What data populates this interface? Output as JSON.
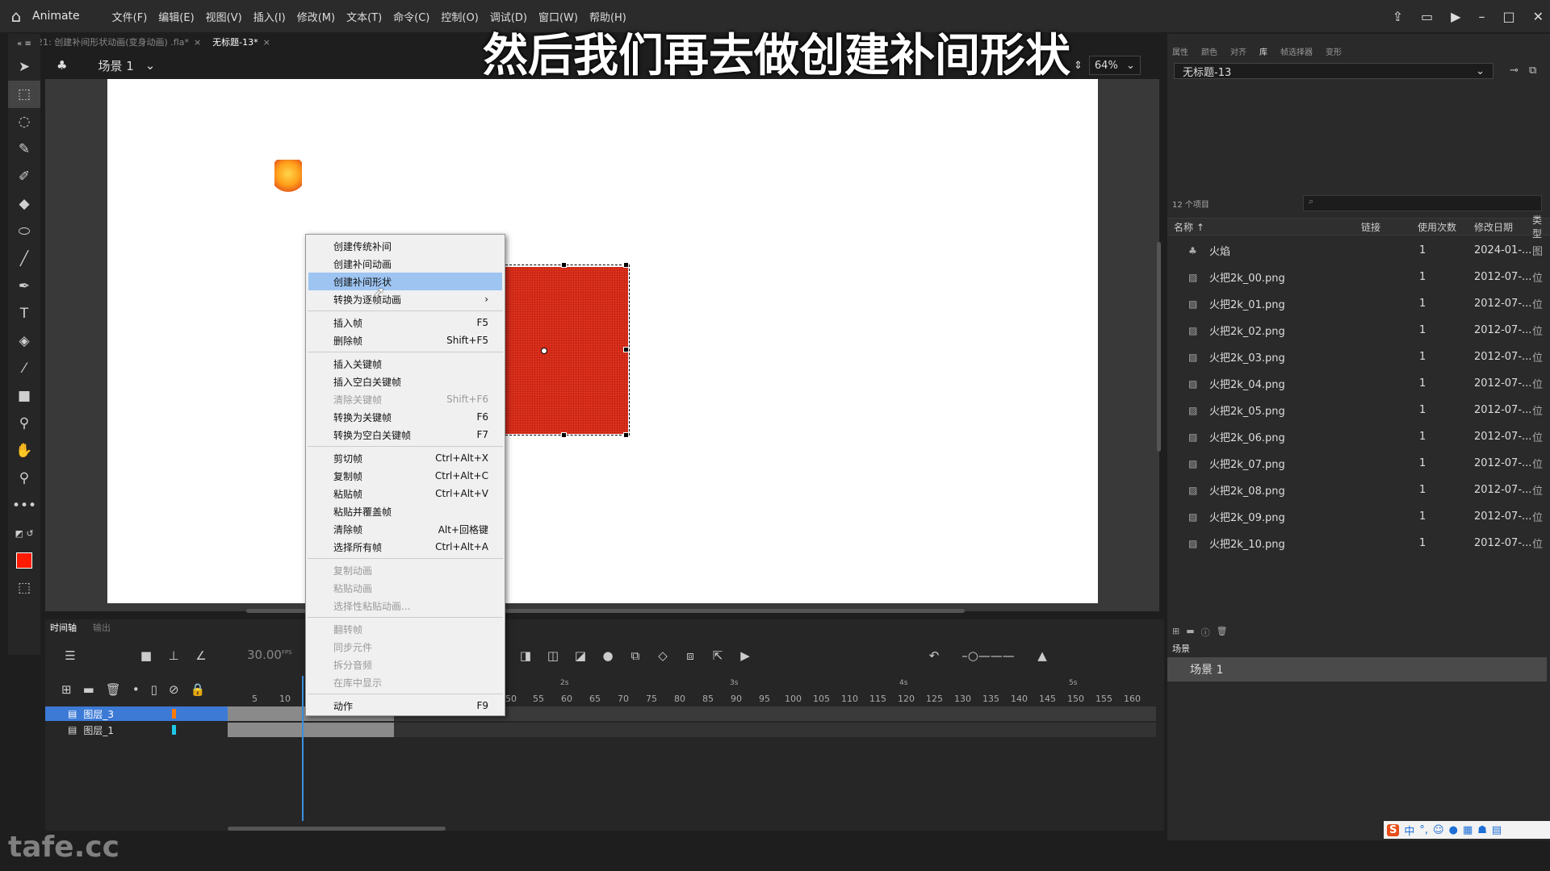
{
  "app": {
    "name": "Animate",
    "menus": [
      "文件(F)",
      "编辑(E)",
      "视图(V)",
      "插入(I)",
      "修改(M)",
      "文本(T)",
      "命令(C)",
      "控制(O)",
      "调试(D)",
      "窗口(W)",
      "帮助(H)"
    ]
  },
  "doc_tabs": [
    {
      "label": "21: 创建补间形状动画(变身动画) .fla*"
    },
    {
      "label": "无标题-13*"
    }
  ],
  "scene_bar": {
    "scene_label": "场景 1"
  },
  "subtitle": "然后我们再去做创建补间形状",
  "zoom": {
    "value": "64%"
  },
  "context_menu": {
    "items": [
      {
        "label": "创建传统补间",
        "shortcut": "",
        "state": "normal"
      },
      {
        "label": "创建补间动画",
        "shortcut": "",
        "state": "normal"
      },
      {
        "label": "创建补间形状",
        "shortcut": "",
        "state": "highlighted"
      },
      {
        "label": "转换为逐帧动画",
        "shortcut": "›",
        "state": "normal"
      },
      {
        "label": "插入帧",
        "shortcut": "F5",
        "state": "normal"
      },
      {
        "label": "删除帧",
        "shortcut": "Shift+F5",
        "state": "normal"
      },
      {
        "label": "插入关键帧",
        "shortcut": "",
        "state": "normal"
      },
      {
        "label": "插入空白关键帧",
        "shortcut": "",
        "state": "normal"
      },
      {
        "label": "清除关键帧",
        "shortcut": "Shift+F6",
        "state": "disabled"
      },
      {
        "label": "转换为关键帧",
        "shortcut": "F6",
        "state": "normal"
      },
      {
        "label": "转换为空白关键帧",
        "shortcut": "F7",
        "state": "normal"
      },
      {
        "label": "剪切帧",
        "shortcut": "Ctrl+Alt+X",
        "state": "normal"
      },
      {
        "label": "复制帧",
        "shortcut": "Ctrl+Alt+C",
        "state": "normal"
      },
      {
        "label": "粘贴帧",
        "shortcut": "Ctrl+Alt+V",
        "state": "normal"
      },
      {
        "label": "粘贴并覆盖帧",
        "shortcut": "",
        "state": "normal"
      },
      {
        "label": "清除帧",
        "shortcut": "Alt+回格键",
        "state": "normal"
      },
      {
        "label": "选择所有帧",
        "shortcut": "Ctrl+Alt+A",
        "state": "normal"
      },
      {
        "label": "复制动画",
        "shortcut": "",
        "state": "disabled"
      },
      {
        "label": "粘贴动画",
        "shortcut": "",
        "state": "disabled"
      },
      {
        "label": "选择性粘贴动画...",
        "shortcut": "",
        "state": "disabled"
      },
      {
        "label": "翻转帧",
        "shortcut": "",
        "state": "disabled"
      },
      {
        "label": "同步元件",
        "shortcut": "",
        "state": "disabled"
      },
      {
        "label": "拆分音频",
        "shortcut": "",
        "state": "disabled"
      },
      {
        "label": "在库中显示",
        "shortcut": "",
        "state": "disabled"
      },
      {
        "label": "动作",
        "shortcut": "F9",
        "state": "normal"
      }
    ]
  },
  "timeline": {
    "tabs": [
      "时间轴",
      "输出"
    ],
    "fps": "30.00",
    "fps_unit": "FPS",
    "ruler": [
      "5",
      "10",
      "50",
      "55",
      "60",
      "65",
      "70",
      "75",
      "80",
      "85",
      "90",
      "95",
      "100",
      "105",
      "110",
      "115",
      "120",
      "125",
      "130",
      "135",
      "140",
      "145",
      "150",
      "155",
      "160"
    ],
    "seconds": [
      "2s",
      "3s",
      "4s",
      "5s"
    ],
    "layers": [
      {
        "name": "图层_3",
        "color": "#ff7a00",
        "selected": true
      },
      {
        "name": "图层_1",
        "color": "#1ec8e6",
        "selected": false
      }
    ]
  },
  "right_panel": {
    "tabs": [
      "属性",
      "颜色",
      "对齐",
      "库",
      "帧选择器",
      "变形"
    ],
    "library_select": "无标题-13",
    "item_count": "12 个项目",
    "columns": [
      "名称 ↑",
      "链接",
      "使用次数",
      "修改日期",
      "类型"
    ],
    "items": [
      {
        "name": "火焰",
        "uses": "1",
        "date": "2024-01-...",
        "type": "图",
        "icon": "graphic-symbol-icon"
      },
      {
        "name": "火把2k_00.png",
        "uses": "1",
        "date": "2012-07-...",
        "type": "位",
        "icon": "bitmap-icon"
      },
      {
        "name": "火把2k_01.png",
        "uses": "1",
        "date": "2012-07-...",
        "type": "位",
        "icon": "bitmap-icon"
      },
      {
        "name": "火把2k_02.png",
        "uses": "1",
        "date": "2012-07-...",
        "type": "位",
        "icon": "bitmap-icon"
      },
      {
        "name": "火把2k_03.png",
        "uses": "1",
        "date": "2012-07-...",
        "type": "位",
        "icon": "bitmap-icon"
      },
      {
        "name": "火把2k_04.png",
        "uses": "1",
        "date": "2012-07-...",
        "type": "位",
        "icon": "bitmap-icon"
      },
      {
        "name": "火把2k_05.png",
        "uses": "1",
        "date": "2012-07-...",
        "type": "位",
        "icon": "bitmap-icon"
      },
      {
        "name": "火把2k_06.png",
        "uses": "1",
        "date": "2012-07-...",
        "type": "位",
        "icon": "bitmap-icon"
      },
      {
        "name": "火把2k_07.png",
        "uses": "1",
        "date": "2012-07-...",
        "type": "位",
        "icon": "bitmap-icon"
      },
      {
        "name": "火把2k_08.png",
        "uses": "1",
        "date": "2012-07-...",
        "type": "位",
        "icon": "bitmap-icon"
      },
      {
        "name": "火把2k_09.png",
        "uses": "1",
        "date": "2012-07-...",
        "type": "位",
        "icon": "bitmap-icon"
      },
      {
        "name": "火把2k_10.png",
        "uses": "1",
        "date": "2012-07-...",
        "type": "位",
        "icon": "bitmap-icon"
      }
    ],
    "scenes_title": "场景",
    "scene_item": "场景 1"
  },
  "watermark": "tafe.cc",
  "ime": {
    "label": "中"
  },
  "colors": {
    "fill": "#ff1a00",
    "stroke": "#000000",
    "accent": "#3c7ad6",
    "menu_highlight": "#9ec5f2"
  }
}
